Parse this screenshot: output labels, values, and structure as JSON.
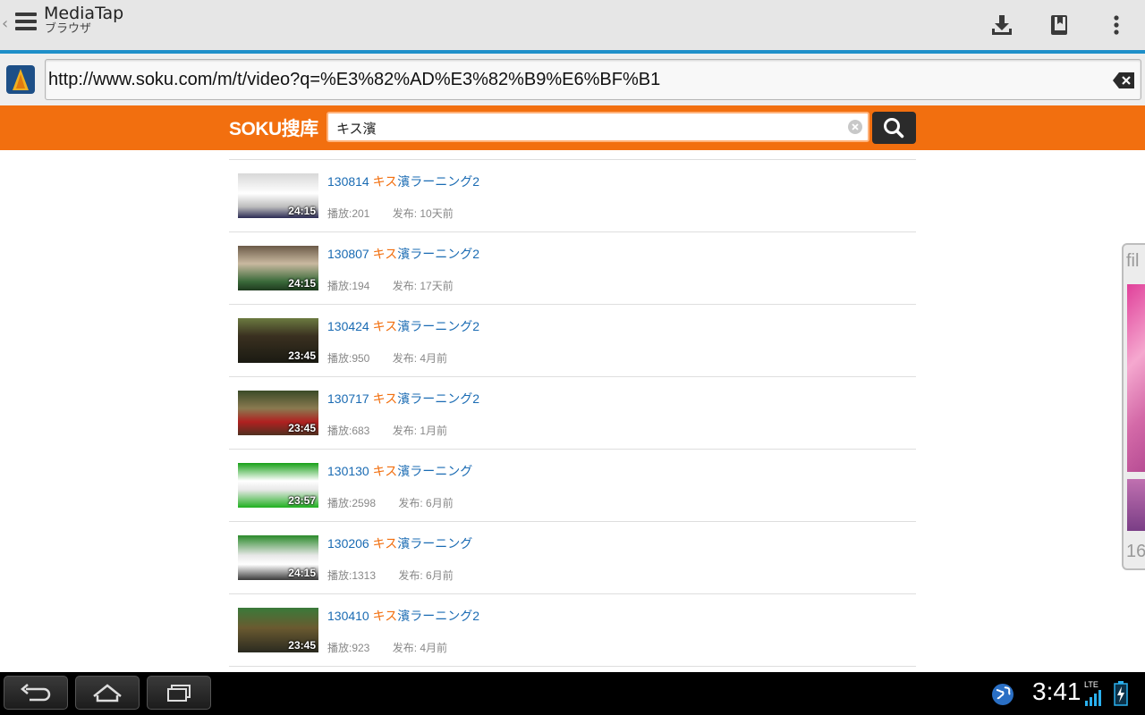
{
  "app": {
    "title": "MediaTap",
    "subtitle": "ブラウザ",
    "actions": [
      "download-icon",
      "bookmarks-icon",
      "overflow-menu-icon"
    ]
  },
  "urlbar": {
    "url": "http://www.soku.com/m/t/video?q=%E3%82%AD%E3%82%B9%E6%BF%B1"
  },
  "soku": {
    "logo": "SOKU搜库",
    "query": "キス濱"
  },
  "results": [
    {
      "prefix": "130814",
      "hl": "キス",
      "rest": "濱ラーニング2",
      "duration": "24:15",
      "plays": "播放:201",
      "published": "发布: 10天前"
    },
    {
      "prefix": "130807",
      "hl": "キス",
      "rest": "濱ラーニング2",
      "duration": "24:15",
      "plays": "播放:194",
      "published": "发布: 17天前"
    },
    {
      "prefix": "130424",
      "hl": "キス",
      "rest": "濱ラーニング2",
      "duration": "23:45",
      "plays": "播放:950",
      "published": "发布: 4月前"
    },
    {
      "prefix": "130717",
      "hl": "キス",
      "rest": "濱ラーニング2",
      "duration": "23:45",
      "plays": "播放:683",
      "published": "发布: 1月前"
    },
    {
      "prefix": "130130",
      "hl": "キス",
      "rest": "濱ラーニング",
      "duration": "23:57",
      "plays": "播放:2598",
      "published": "发布: 6月前"
    },
    {
      "prefix": "130206",
      "hl": "キス",
      "rest": "濱ラーニング",
      "duration": "24:15",
      "plays": "播放:1313",
      "published": "发布: 6月前"
    },
    {
      "prefix": "130410",
      "hl": "キス",
      "rest": "濱ラーニング2",
      "duration": "23:45",
      "plays": "播放:923",
      "published": "发布: 4月前"
    }
  ],
  "sidepanel": {
    "top_label": "fil",
    "bottom_label": "16"
  },
  "system": {
    "time": "3:41",
    "network": "LTE"
  },
  "colors": {
    "accent_blue": "#1f8fc9",
    "soku_orange": "#f26f0f",
    "link_blue": "#1a6bb3"
  }
}
